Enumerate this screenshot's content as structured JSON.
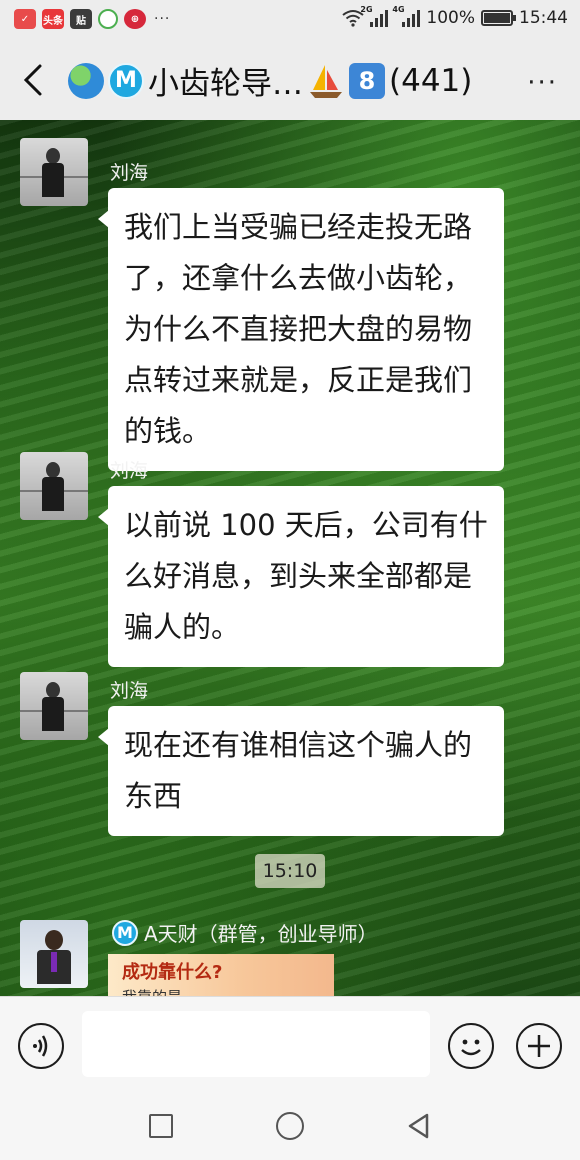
{
  "status_bar": {
    "app_icons": [
      {
        "name": "app-icon-1",
        "color": "#e84b4b"
      },
      {
        "name": "toutiao-app-icon",
        "label": "头条",
        "color": "#e8373a"
      },
      {
        "name": "tieba-app-icon",
        "label": "贴",
        "color": "#3b3b3b"
      },
      {
        "name": "app-icon-4",
        "color": "#4caf50"
      },
      {
        "name": "bank-app-icon",
        "color": "#d6283b"
      }
    ],
    "more": "···",
    "network_1": "2G",
    "network_2": "4G",
    "battery": "100%",
    "battery_level": 1.0,
    "time": "15:44"
  },
  "header": {
    "title": "小齿轮导…",
    "badge_m": "M",
    "badge_number": "8",
    "member_count": "(441)",
    "more": "···"
  },
  "messages": [
    {
      "sender": "刘海",
      "text": "我们上当受骗已经走投无路了，还拿什么去做小齿轮，为什么不直接把大盘的易物点转过来就是，反正是我们的钱。"
    },
    {
      "sender": "刘海",
      "text": "以前说 100 天后，公司有什么好消息，到头来全部都是骗人的。"
    },
    {
      "sender": "刘海",
      "text": "现在还有谁相信这个骗人的东西"
    }
  ],
  "timestamp": "15:10",
  "last_message": {
    "badge": "M",
    "sender": "A天财（群管，创业导师）",
    "card_title": "成功靠什么?",
    "card_subtitle": "我靠的是"
  }
}
